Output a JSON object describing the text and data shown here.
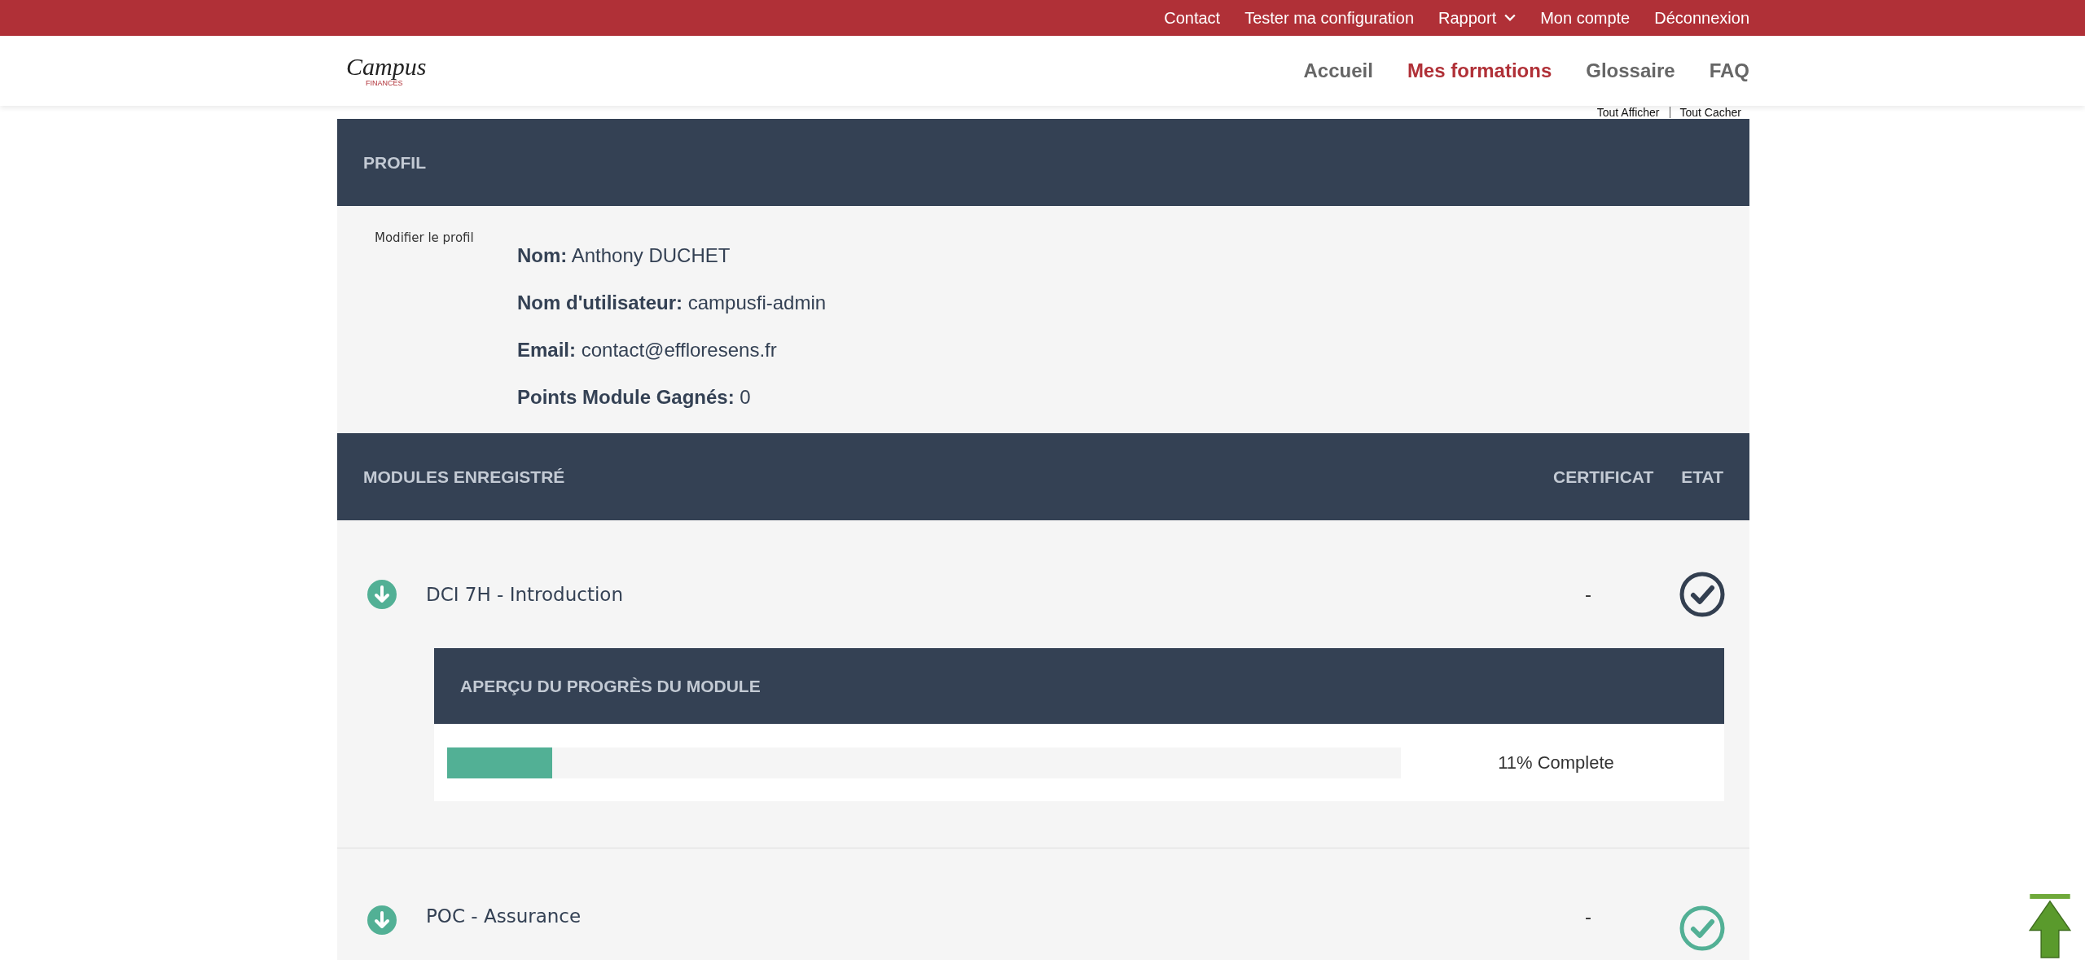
{
  "top_bar": {
    "links": [
      {
        "label": "Contact",
        "dropdown": false
      },
      {
        "label": "Tester ma configuration",
        "dropdown": false
      },
      {
        "label": "Rapport",
        "dropdown": true
      },
      {
        "label": "Mon compte",
        "dropdown": false
      },
      {
        "label": "Déconnexion",
        "dropdown": false
      }
    ]
  },
  "logo": {
    "script": "Campus",
    "subtitle": "FINANCES"
  },
  "nav": {
    "items": [
      {
        "label": "Accueil",
        "selected": false
      },
      {
        "label": "Mes formations",
        "selected": true
      },
      {
        "label": "Glossaire",
        "selected": false
      },
      {
        "label": "FAQ",
        "selected": false
      }
    ]
  },
  "toggles": [
    "Tout Afficher",
    "Tout Cacher"
  ],
  "profile": {
    "title": "PROFIL",
    "edit_link": "Modifier le profil",
    "fields": [
      {
        "label": "Nom:",
        "value": "Anthony DUCHET"
      },
      {
        "label": "Nom d'utilisateur:",
        "value": "campusfi-admin"
      },
      {
        "label": "Email:",
        "value": "contact@effloresens.fr"
      },
      {
        "label": "Points Module Gagnés:",
        "value": "0"
      }
    ]
  },
  "modules": {
    "title": "MODULES ENREGISTRÉ",
    "columns": [
      "CERTIFICAT",
      "ETAT"
    ],
    "rows": [
      {
        "name": "DCI 7H - Introduction",
        "certificate": "-",
        "color": "#333f50",
        "expanded": true,
        "progress": {
          "title": "APERÇU DU PROGRÈS DU MODULE",
          "level": 0.11,
          "reading": "11% Complete"
        }
      },
      {
        "name": "POC - Assurance",
        "certificate": "-",
        "color": "#52b095"
      }
    ]
  }
}
